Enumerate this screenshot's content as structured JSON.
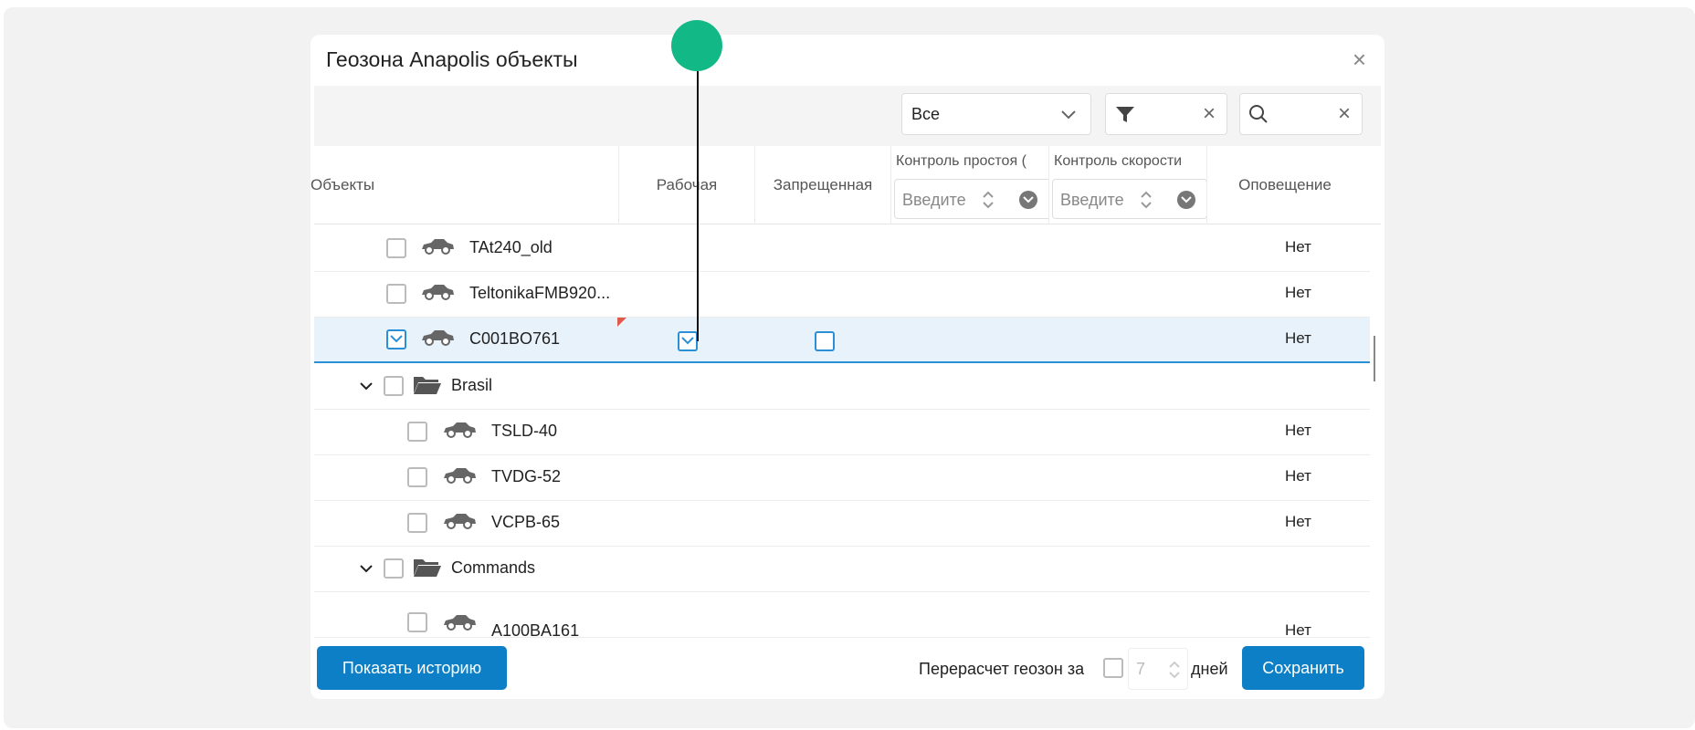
{
  "dialog": {
    "title": "Геозона Anapolis объекты",
    "close_label": "×"
  },
  "toolbar": {
    "filter_select_value": "Все",
    "filter_clear": "×",
    "search_clear": "×",
    "icons": [
      "chevron-down-icon",
      "filter-icon",
      "search-icon"
    ]
  },
  "columns": {
    "objects": "Объекты",
    "work": "Рабочая",
    "forbidden": "Запрещенная",
    "idle_control": "Контроль простоя (",
    "speed_control": "Контроль скорости",
    "notify": "Оповещение",
    "idle_placeholder": "Введите",
    "speed_placeholder": "Введите"
  },
  "rows": [
    {
      "type": "object",
      "name": "TAt240_old",
      "notify": "Нет",
      "checked": false
    },
    {
      "type": "object",
      "name": "TeltonikaFMB920...",
      "notify": "Нет",
      "checked": false
    },
    {
      "type": "object",
      "name": "C001BO761",
      "notify": "Нет",
      "checked": true,
      "work": true,
      "forbidden": false,
      "selected": true
    },
    {
      "type": "group",
      "name": "Brasil"
    },
    {
      "type": "object",
      "name": "TSLD-40",
      "notify": "Нет",
      "checked": false
    },
    {
      "type": "object",
      "name": "TVDG-52",
      "notify": "Нет",
      "checked": false
    },
    {
      "type": "object",
      "name": "VCPB-65",
      "notify": "Нет",
      "checked": false
    },
    {
      "type": "group",
      "name": "Commands"
    },
    {
      "type": "object",
      "name": "A100BA161",
      "notify": "Нет",
      "checked": false
    }
  ],
  "footer": {
    "history_button": "Показать историю",
    "recalc_label": "Перерасчет геозон за",
    "days_value": "7",
    "days_label": "дней",
    "save_button": "Сохранить"
  },
  "colors": {
    "accent": "#0d7fc7",
    "selected_row": "#e8f2fb",
    "annotation_dot": "#12b886"
  }
}
